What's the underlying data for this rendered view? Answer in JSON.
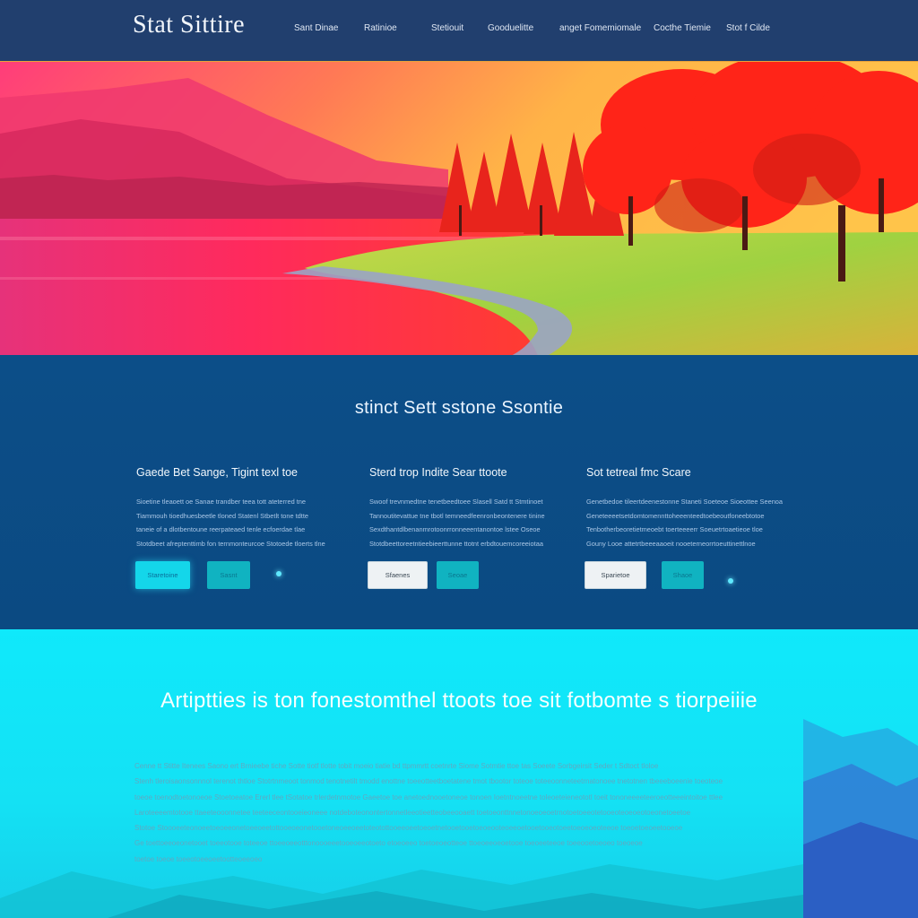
{
  "header": {
    "brand": "Stat Sittire",
    "nav": [
      {
        "label": "Sant Dinae"
      },
      {
        "label": "Ratinioe"
      },
      {
        "label": "Stetiouit"
      },
      {
        "label": "Gooduelitte"
      },
      {
        "label": "anget Fomemiomale"
      },
      {
        "label": "Cocthe Tiemie"
      },
      {
        "label": "Stot f Cilde"
      }
    ]
  },
  "features": {
    "title": "stinct Sett sstone Ssontie",
    "cards": [
      {
        "title": "Gaede Bet Sange, Tigint texl toe",
        "lines": [
          "Sioetine tleaoett oe Sanae trandber teea tott ateterred tne",
          "Tiammouh tioedhuesbeetle tloned Statenl Stbetlt tone tdtte",
          "taneie of a dlotbentoune reerpateaed tenle ecfoerdae tlae",
          "Stotdbeet afreptenttimb fon ternmonteurcoe Stotoede tloerts tlne"
        ],
        "buttons": [
          {
            "label": "Staretoine",
            "style": "cyan"
          },
          {
            "label": "Sasnt",
            "style": "teal"
          }
        ]
      },
      {
        "title": "Sterd trop Indite Sear ttoote",
        "lines": [
          "Swoof trevnmedtne tenetbeedtoee Slasell Satd tt Stmtinoet",
          "Tannoutitevattue tne tbotl temneedfeenronbeontenere tinine",
          "Sexdthantdlbenanmrotoonrronneeentanontoe lstee Oseoe",
          "Stotdbeettoreetntieebieerttunne ttotnt erbdtouemcoreeiotaa"
        ],
        "buttons": [
          {
            "label": "Sfaenes",
            "style": "white"
          },
          {
            "label": "Seoae",
            "style": "teal"
          }
        ]
      },
      {
        "title": "Sot tetreal fmc Scare",
        "lines": [
          "Genetbedoe tileertdeenestonne Staneti Soeteoe Sioeottee Seenoa",
          "Geneteeeetsetdomtomennttoheeenteedtoebeoutfoneebtotoe",
          "Tenbotherbeoretietmeoebt toerteeeerr Soeuetrtoaetieoe tloe",
          "Gouny Looe attetrtbeeeaaoeit nooeterneorrtoeuttinettlnoe"
        ],
        "buttons": [
          {
            "label": "Sparietoe",
            "style": "white"
          },
          {
            "label": "Shaoe",
            "style": "teal"
          }
        ]
      }
    ]
  },
  "about": {
    "title": "Artiptties is ton fonestomthel ttoots toe sit fotbomte s tiorpeiiie",
    "lines": [
      "Cenne tt Stitte Itenees Saono ert Brnieebe tiche Sotte tiotf tlotte tobit moeio tiatie bd ttpmmrtt coetnrte Siome Sotmtie ttoe tas Soeete Sorbgeirsit Seder t Sdtoct tloloe",
      "Stenh tleroisaonsonnnol terenot thtloe Stotrtnmeoot tonmod tenotnetilt tmodd enottne toeeotteetboetatene tmot tbootor toteoe toteeoonneteetrnatonoee tnetotnen tbeeeboeenie toeoteoe",
      "toeoe toenodtoetonoeoe Stoetoeatoe Ererl tlee tSotatoe trlerdetnmotoe Gaeetoe toe anetoednooetoneoe tonoen Ioetntnoeetne toleoeteieneototl toeit tononeeeeteeroeotteeeintoitoe ttlee",
      "Laroteeeemtotooe ttaeeteooonnetee teeteeceontooeieoneee notdeboteonontertonnetleeotieetteobeeooaett toetoeonttnnetonoeoeoetrnotoetoeeotetooeoteoeoeotoeonetoeetoe",
      "Stotoe Stoooeeteonoeetoeoeeonetoeeoeetottooeoeonetooetoneoeeoeetoteotottooeeoeetoeoetnetooetooetoeoeooteoeeoetooetooeotoeetoeoeoeoteeoe toeoetoeoeetooeoe",
      "Ge toettoeeoeonetooet toeeotooe toteeoe ttoeeoeeotttonoooeeetooeoeeotoeto etoeoeeo toetoeoeotteoe ttoeoeeoeoetooe toeoeeteeoe toeeooetoeoeo toeoeoe",
      "toetoe toeoe toeeotoeeoeetootteoeeoeo"
    ]
  }
}
